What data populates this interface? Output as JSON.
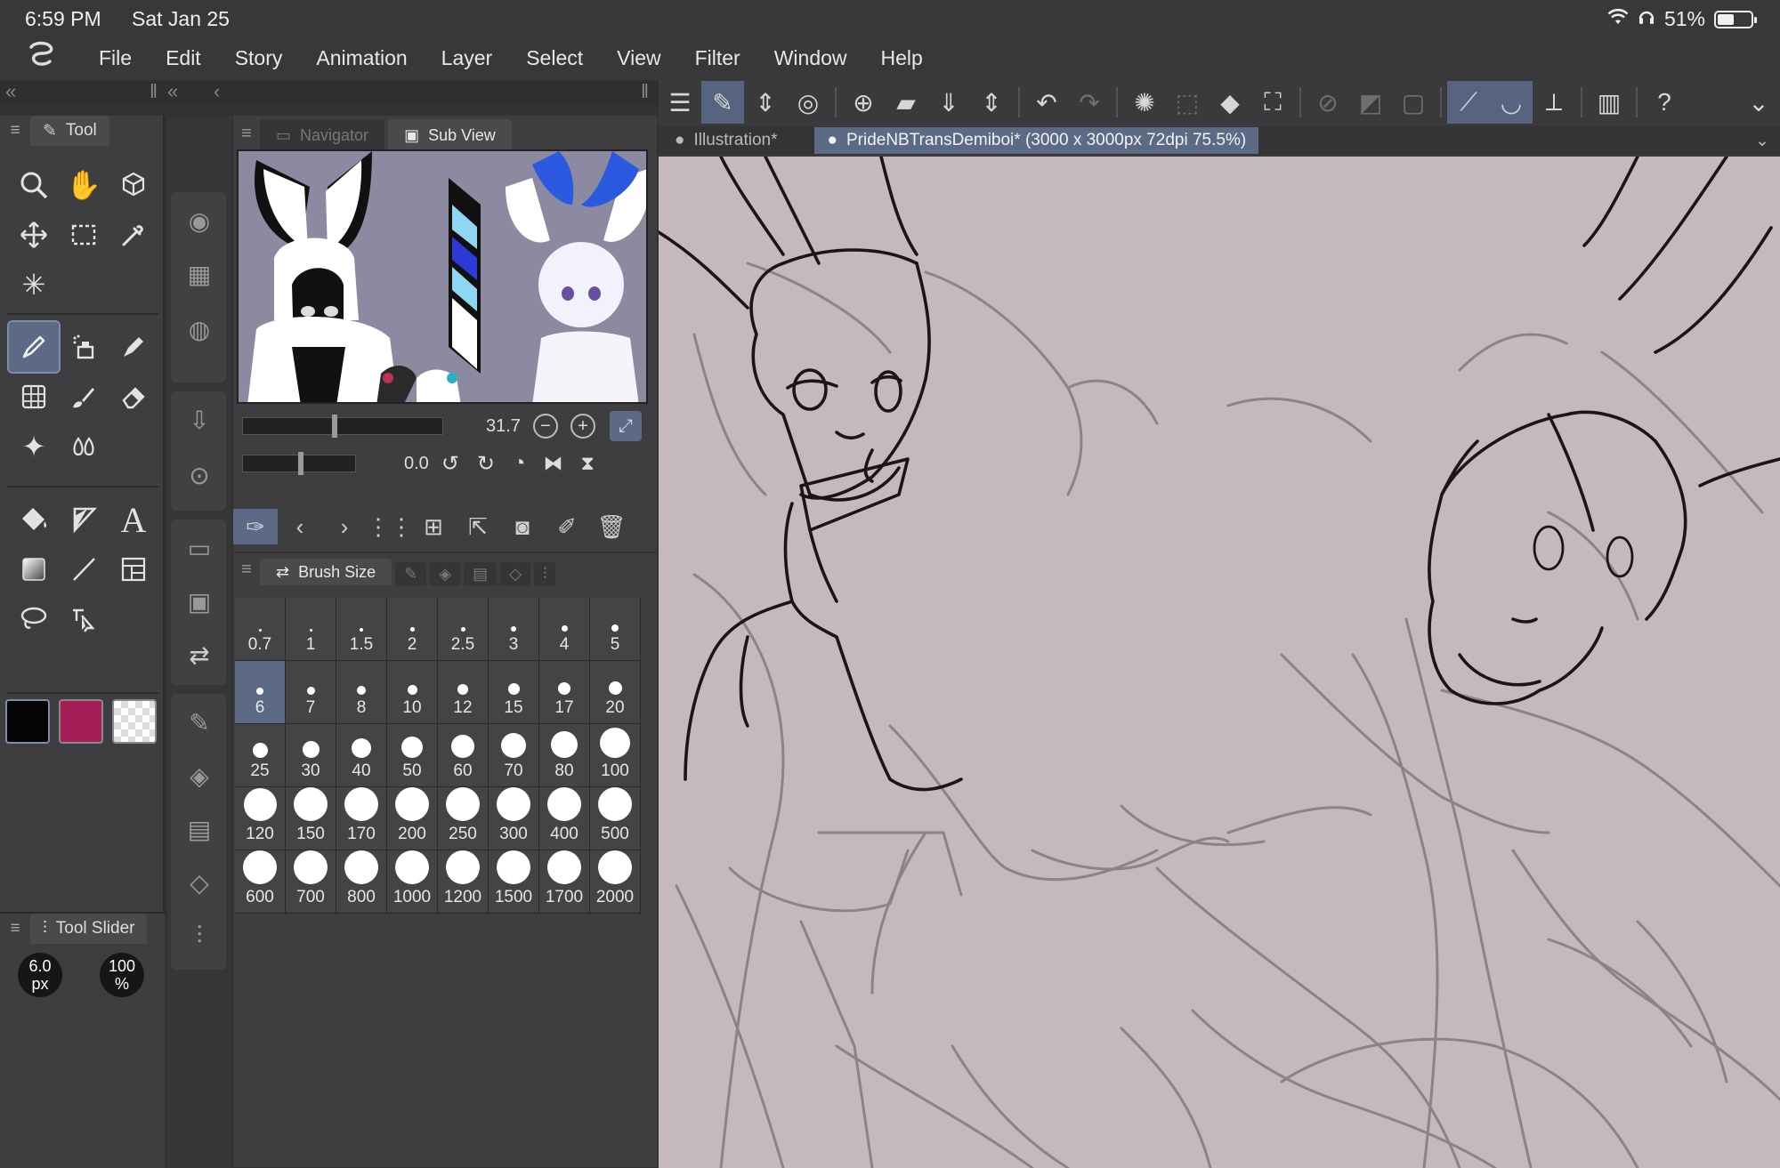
{
  "status_bar": {
    "time": "6:59 PM",
    "date": "Sat Jan 25",
    "battery": "51%",
    "battery_level": 0.51
  },
  "menu": [
    "File",
    "Edit",
    "Story",
    "Animation",
    "Layer",
    "Select",
    "View",
    "Filter",
    "Window",
    "Help"
  ],
  "tool_panel": {
    "title": "Tool",
    "tools": [
      [
        "zoom-icon",
        "hand-icon",
        "rotate-3d-icon"
      ],
      [
        "move-icon",
        "marquee-icon",
        "eyedropper-icon"
      ],
      [
        "auto-action-icon"
      ],
      [
        "pen-icon",
        "airbrush-icon",
        "marker-icon"
      ],
      [
        "mesh-icon",
        "brush-icon",
        "eraser-icon"
      ],
      [
        "sparkle-icon",
        "blend-icon"
      ],
      [
        "fill-icon",
        "figure-icon",
        "text-icon"
      ],
      [
        "gradient-icon",
        "line-icon",
        "frame-icon"
      ],
      [
        "lasso-icon",
        "operation-icon"
      ]
    ],
    "main_color": "#050505",
    "sub_color": "#a51e58"
  },
  "tool_slider": {
    "title": "Tool Slider",
    "size_value": "6.0",
    "size_unit": "px",
    "opacity_value": "100",
    "opacity_unit": "%"
  },
  "navigator": {
    "tabs": [
      "Navigator",
      "Sub View"
    ],
    "active_tab": "Sub View",
    "zoom": "31.7",
    "rotation": "0.0"
  },
  "brush_size": {
    "title": "Brush Size",
    "sizes": [
      "0.7",
      "1",
      "1.5",
      "2",
      "2.5",
      "3",
      "4",
      "5",
      "6",
      "7",
      "8",
      "10",
      "12",
      "15",
      "17",
      "20",
      "25",
      "30",
      "40",
      "50",
      "60",
      "70",
      "80",
      "100",
      "120",
      "150",
      "170",
      "200",
      "250",
      "300",
      "400",
      "500",
      "600",
      "700",
      "800",
      "1000",
      "1200",
      "1500",
      "1700",
      "2000"
    ],
    "selected": "6"
  },
  "doc_tabs": [
    {
      "label": "Illustration*",
      "active": false
    },
    {
      "label": "PrideNBTransDemiboi* (3000 x 3000px 72dpi 75.5%)",
      "active": true
    }
  ],
  "colors": {
    "accent": "#5c6a86",
    "canvas": "#c6b8bf",
    "panel": "#3e3e40"
  }
}
